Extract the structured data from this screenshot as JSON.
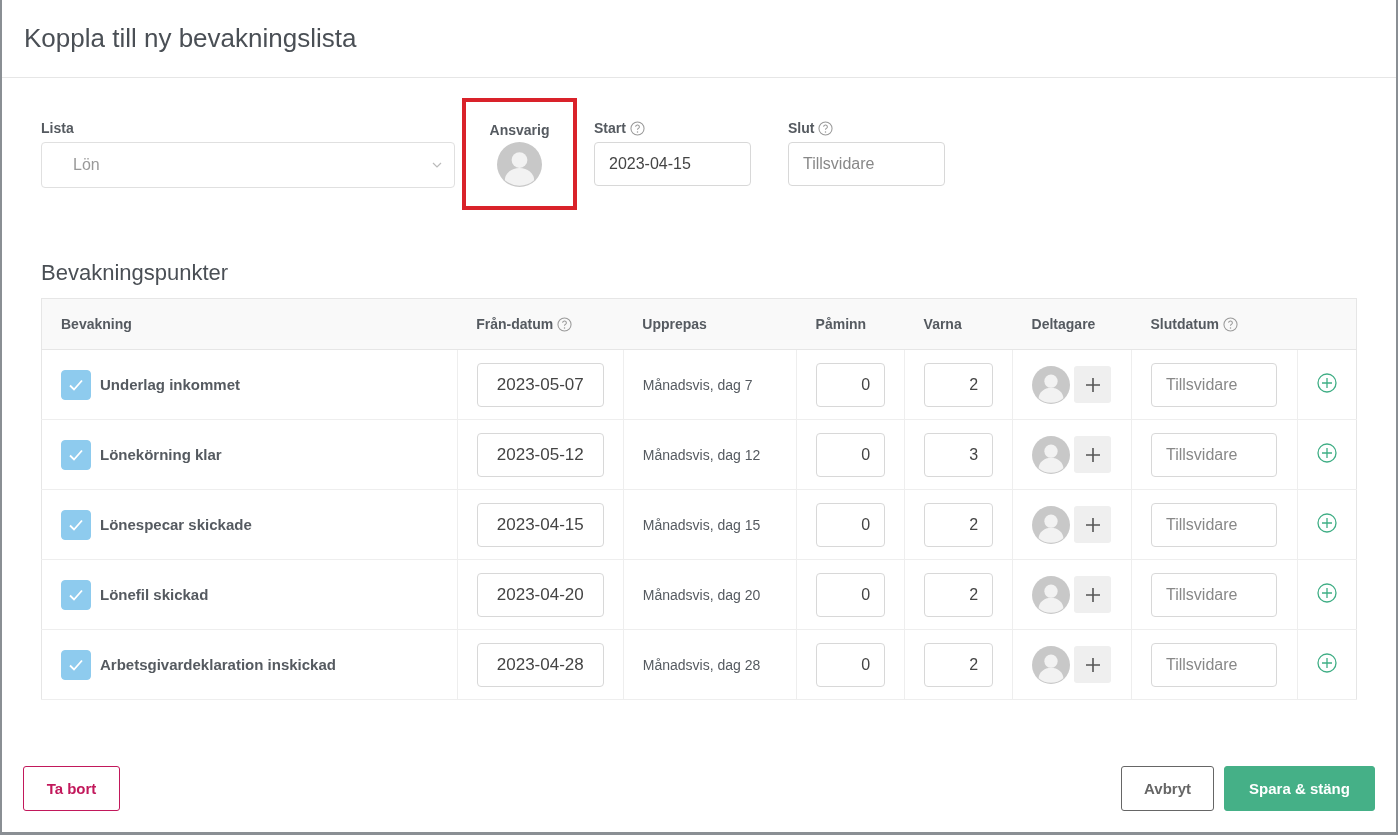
{
  "dialog": {
    "title": "Koppla till ny bevakningslista"
  },
  "list_field": {
    "label": "Lista",
    "value": "Lön",
    "disabled": true
  },
  "responsible": {
    "label": "Ansvarig",
    "highlighted": true
  },
  "start_field": {
    "label": "Start",
    "value": "2023-04-15"
  },
  "end_field": {
    "label": "Slut",
    "placeholder": "Tillsvidare"
  },
  "section_title": "Bevakningspunkter",
  "columns": [
    {
      "label": "Bevakning",
      "help": false
    },
    {
      "label": "Från-datum",
      "help": true
    },
    {
      "label": "Upprepas",
      "help": false
    },
    {
      "label": "Påminn",
      "help": false
    },
    {
      "label": "Varna",
      "help": false
    },
    {
      "label": "Deltagare",
      "help": false
    },
    {
      "label": "Slutdatum",
      "help": true
    }
  ],
  "rows": [
    {
      "checked": true,
      "name": "Underlag inkommet",
      "from": "2023-05-07",
      "repeat": "Månadsvis, dag 7",
      "remind": "0",
      "warn": "2",
      "end_placeholder": "Tillsvidare"
    },
    {
      "checked": true,
      "name": "Lönekörning klar",
      "from": "2023-05-12",
      "repeat": "Månadsvis, dag 12",
      "remind": "0",
      "warn": "3",
      "end_placeholder": "Tillsvidare"
    },
    {
      "checked": true,
      "name": "Lönespecar skickade",
      "from": "2023-04-15",
      "repeat": "Månadsvis, dag 15",
      "remind": "0",
      "warn": "2",
      "end_placeholder": "Tillsvidare"
    },
    {
      "checked": true,
      "name": "Lönefil skickad",
      "from": "2023-04-20",
      "repeat": "Månadsvis, dag 20",
      "remind": "0",
      "warn": "2",
      "end_placeholder": "Tillsvidare"
    },
    {
      "checked": true,
      "name": "Arbetsgivardeklaration inskickad",
      "from": "2023-04-28",
      "repeat": "Månadsvis, dag 28",
      "remind": "0",
      "warn": "2",
      "end_placeholder": "Tillsvidare"
    }
  ],
  "footer": {
    "delete": "Ta bort",
    "cancel": "Avbryt",
    "save": "Spara & stäng"
  }
}
